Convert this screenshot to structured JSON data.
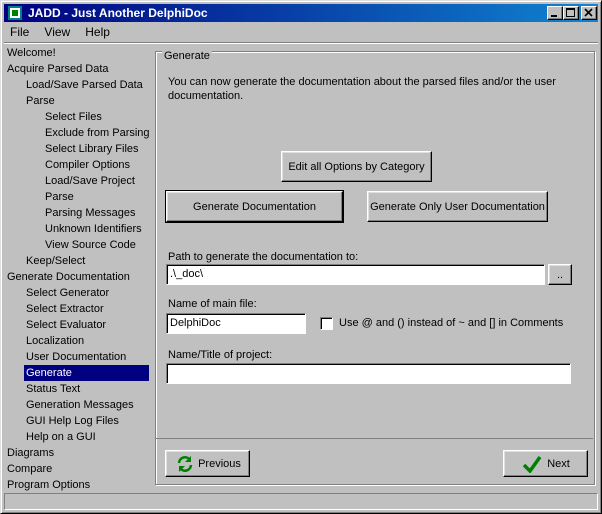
{
  "window": {
    "title": "JADD - Just Another DelphiDoc"
  },
  "menu": [
    "File",
    "View",
    "Help"
  ],
  "tree": [
    {
      "label": "Welcome!",
      "level": 0
    },
    {
      "label": "Acquire Parsed Data",
      "level": 0
    },
    {
      "label": "Load/Save Parsed Data",
      "level": 1
    },
    {
      "label": "Parse",
      "level": 1
    },
    {
      "label": "Select Files",
      "level": 2
    },
    {
      "label": "Exclude from Parsing",
      "level": 2
    },
    {
      "label": "Select Library Files",
      "level": 2
    },
    {
      "label": "Compiler Options",
      "level": 2
    },
    {
      "label": "Load/Save Project",
      "level": 2
    },
    {
      "label": "Parse",
      "level": 2
    },
    {
      "label": "Parsing Messages",
      "level": 2
    },
    {
      "label": "Unknown Identifiers",
      "level": 2
    },
    {
      "label": "View Source Code",
      "level": 2
    },
    {
      "label": "Keep/Select",
      "level": 1
    },
    {
      "label": "Generate Documentation",
      "level": 0
    },
    {
      "label": "Select Generator",
      "level": 1
    },
    {
      "label": "Select Extractor",
      "level": 1
    },
    {
      "label": "Select Evaluator",
      "level": 1
    },
    {
      "label": "Localization",
      "level": 1
    },
    {
      "label": "User Documentation",
      "level": 1
    },
    {
      "label": "Generate",
      "level": 1,
      "selected": true
    },
    {
      "label": "Status Text",
      "level": 1
    },
    {
      "label": "Generation Messages",
      "level": 1
    },
    {
      "label": "GUI Help Log Files",
      "level": 1
    },
    {
      "label": "Help on a GUI",
      "level": 1
    },
    {
      "label": "Diagrams",
      "level": 0
    },
    {
      "label": "Compare",
      "level": 0
    },
    {
      "label": "Program Options",
      "level": 0
    }
  ],
  "generate": {
    "group_title": "Generate",
    "description": "You can now generate the documentation about the parsed files and/or the user documentation.",
    "edit_options_button": "Edit all Options by Category",
    "generate_doc_button": "Generate Documentation",
    "generate_user_doc_button": "Generate Only User Documentation",
    "path_label": "Path to generate the documentation to:",
    "path_value": ".\\_doc\\",
    "browse_button": "..",
    "main_file_label": "Name of main file:",
    "main_file_value": "DelphiDoc",
    "use_at_checkbox_label": "Use @ and () instead of ~ and [] in Comments",
    "use_at_checked": false,
    "project_title_label": "Name/Title of project:",
    "project_title_value": "",
    "previous_button": "Previous",
    "next_button": "Next"
  },
  "colors": {
    "selection": "#000080",
    "titlebar": "#000080",
    "face": "#c0c0c0"
  }
}
